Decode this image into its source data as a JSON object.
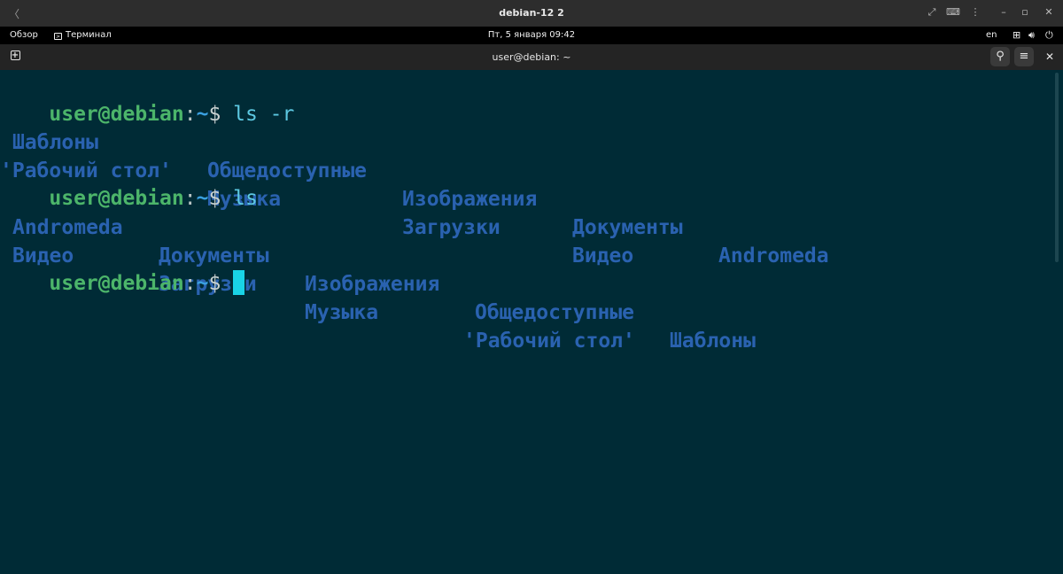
{
  "vm_bar": {
    "title": "debian-12 2"
  },
  "panel": {
    "activities": "Обзор",
    "app_name": "Терминал",
    "clock": "Пт, 5 января  09:42",
    "lang": "en"
  },
  "terminal": {
    "title": "user@debian: ~",
    "prompt": {
      "user": "user@debian",
      "colon": ":",
      "path": "~",
      "dollar": "$"
    },
    "commands": [
      " ls -r",
      " ls"
    ],
    "output_ls_r": [
      [
        "Шаблоны",
        "Общедоступные",
        "Изображения",
        "Документы",
        "Andromeda"
      ],
      [
        "'Рабочий стол'",
        "Музыка",
        "Загрузки",
        "Видео"
      ]
    ],
    "output_ls": [
      [
        "Andromeda",
        "Документы",
        "Изображения",
        "Общедоступные",
        "Шаблоны"
      ],
      [
        "Видео",
        "Загрузки",
        "Музыка",
        "'Рабочий стол'"
      ]
    ]
  },
  "colors": {
    "terminal_bg": "#002b36",
    "prompt_user": "#4cb56a",
    "directory": "#2a62b0",
    "cursor": "#19d3e6"
  }
}
